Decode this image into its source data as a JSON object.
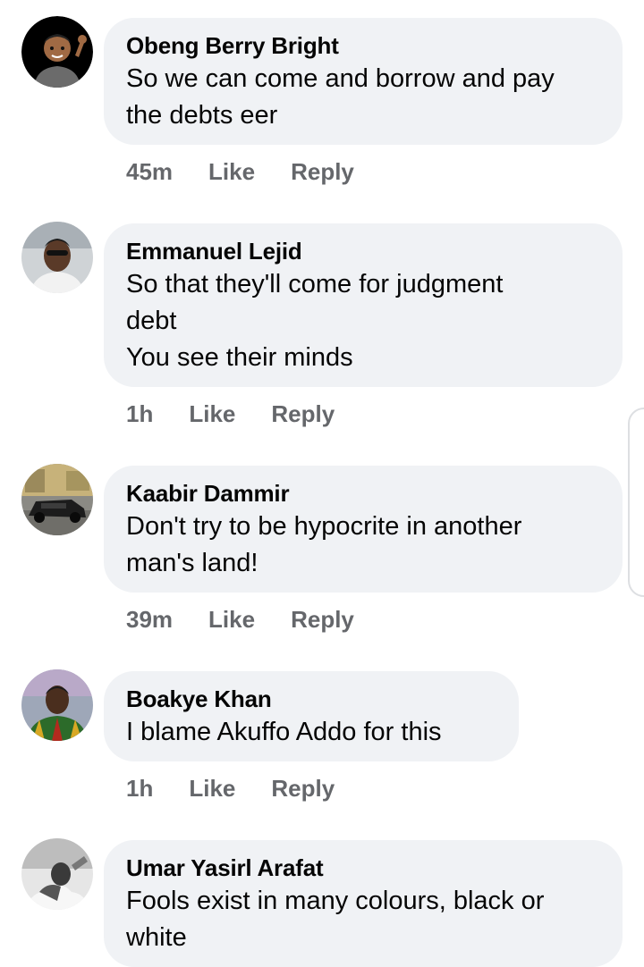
{
  "comments": [
    {
      "name": "Obeng Berry Bright",
      "text": "So we can come and borrow and pay\nthe debts eer",
      "time": "45m",
      "like": "Like",
      "reply": "Reply"
    },
    {
      "name": "Emmanuel Lejid",
      "text": "So that they'll come for judgment\ndebt\nYou see their minds",
      "time": "1h",
      "like": "Like",
      "reply": "Reply"
    },
    {
      "name": "Kaabir Dammir",
      "text": "Don't try to be hypocrite in another\nman's land!",
      "time": "39m",
      "like": "Like",
      "reply": "Reply"
    },
    {
      "name": "Boakye Khan",
      "text": "I blame Akuffo Addo for this",
      "time": "1h",
      "like": "Like",
      "reply": "Reply"
    },
    {
      "name": "Umar Yasirl Arafat",
      "text": "Fools exist in many colours, black or\nwhite",
      "time": "",
      "like": "",
      "reply": ""
    }
  ],
  "colors": {
    "bubble": "#f0f2f5",
    "meta_text": "#65676b",
    "name_text": "#050505"
  },
  "icons": {
    "avatar_1": "bitmoji-avatar-icon",
    "avatar_2": "profile-photo-icon",
    "avatar_3": "car-photo-icon",
    "avatar_4": "kente-photo-icon",
    "avatar_5": "bw-photo-icon"
  }
}
